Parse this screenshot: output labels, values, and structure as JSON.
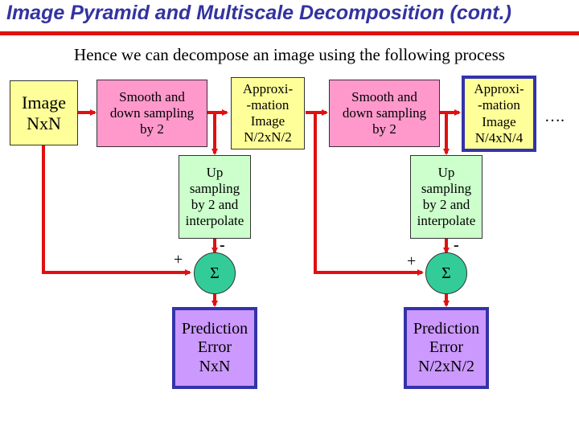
{
  "title": "Image Pyramid and Multiscale Decomposition (cont.)",
  "subtitle": "Hence we can decompose an image using the following process",
  "colors": {
    "title": "#3333a0",
    "rule": "#e01010",
    "arrow": "#e01010"
  },
  "blocks": {
    "input": "Image\nNxN",
    "smooth1": "Smooth and\ndown sampling\nby 2",
    "approx1": "Approxi-\n-mation\nImage\nN/2xN/2",
    "up1": "Up\nsampling\nby 2 and\ninterpolate",
    "sum1": "Σ",
    "plus1": "+",
    "minus1": "-",
    "error1": "Prediction\nError\nNxN",
    "smooth2": "Smooth and\ndown sampling\nby 2",
    "approx2": "Approxi-\n-mation\nImage\nN/4xN/4",
    "up2": "Up\nsampling\nby 2 and\ninterpolate",
    "sum2": "Σ",
    "plus2": "+",
    "minus2": "-",
    "error2": "Prediction\nError\nN/2xN/2",
    "ellipsis": "…."
  }
}
